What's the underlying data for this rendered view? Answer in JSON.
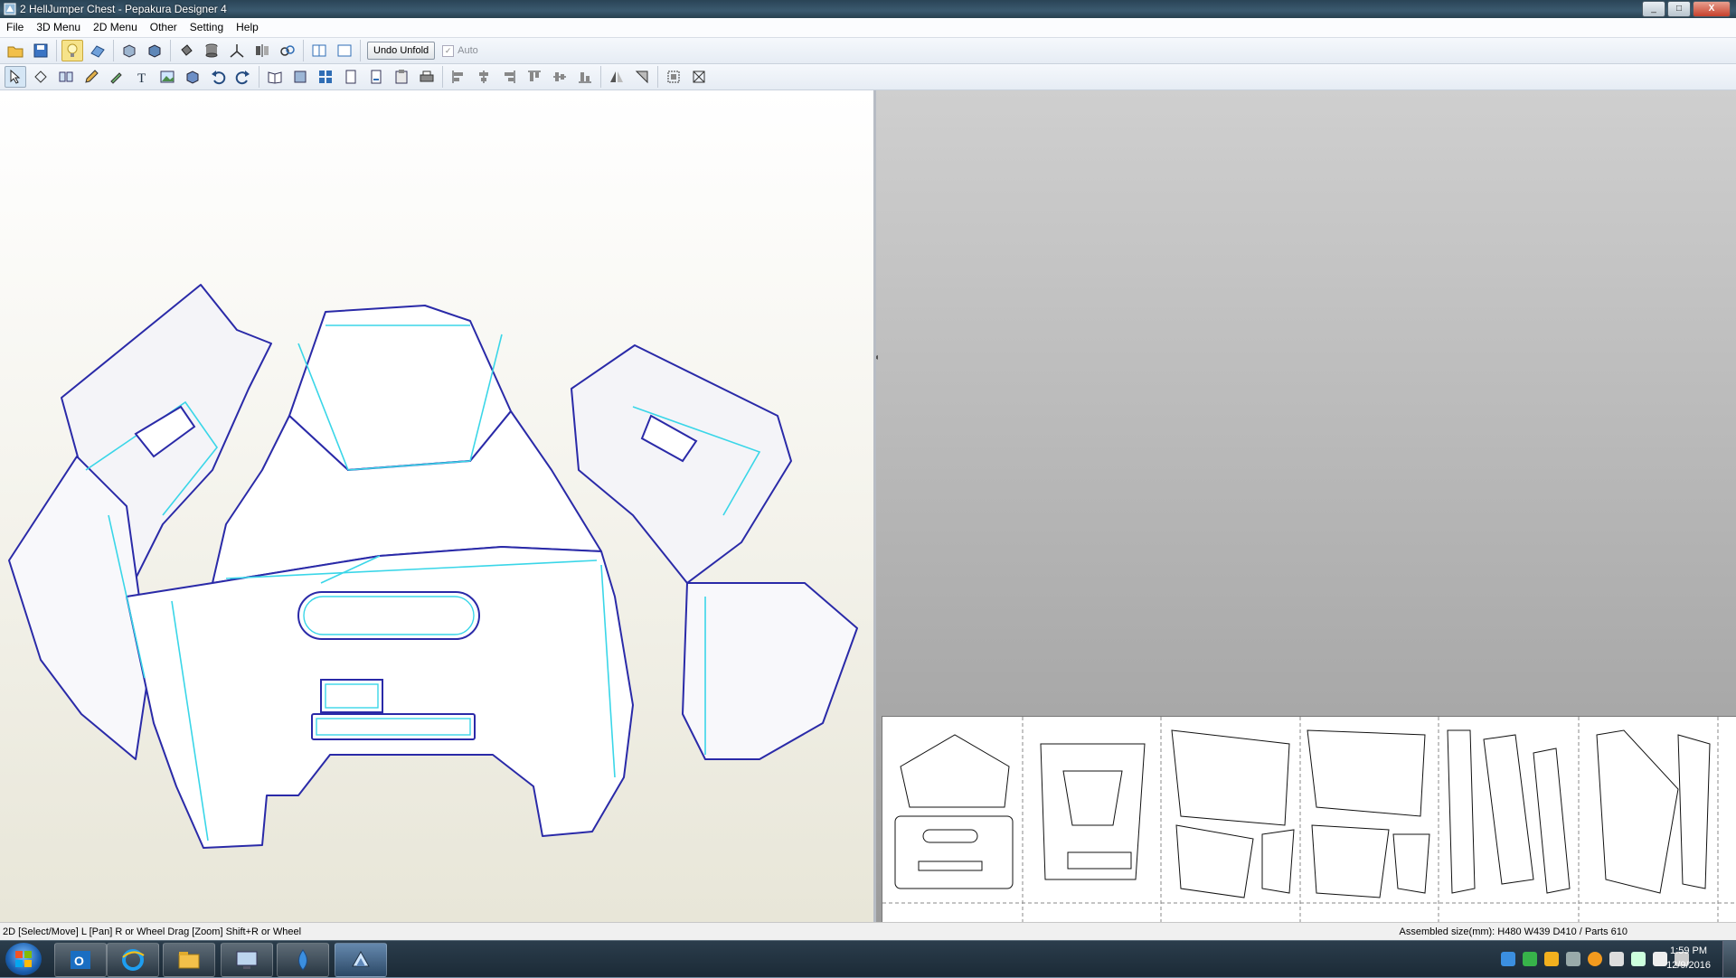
{
  "window": {
    "title": "2 HellJumper Chest - Pepakura Designer 4",
    "controls": [
      "_",
      "□",
      "X"
    ]
  },
  "menu": [
    "File",
    "3D Menu",
    "2D Menu",
    "Other",
    "Setting",
    "Help"
  ],
  "toolbar1": {
    "undo_unfold_label": "Undo Unfold",
    "auto_label": "Auto",
    "auto_checked": true
  },
  "statusbar": {
    "hint": "2D [Select/Move] L [Pan] R or Wheel Drag [Zoom] Shift+R or Wheel",
    "assembled": "Assembled size(mm): H480 W439 D410 / Parts 610"
  },
  "taskbar": {
    "items": [
      "outlook-icon",
      "internet-explorer-icon",
      "file-explorer-icon",
      "remote-desktop-icon",
      "water-drop-icon",
      "pepakura-icon"
    ],
    "clock_time": "1:59 PM",
    "clock_date": "12/9/2016"
  },
  "colors": {
    "model_outline": "#2a2aa8",
    "model_fold": "#3ad6e8",
    "accent": "#3b5a70"
  }
}
